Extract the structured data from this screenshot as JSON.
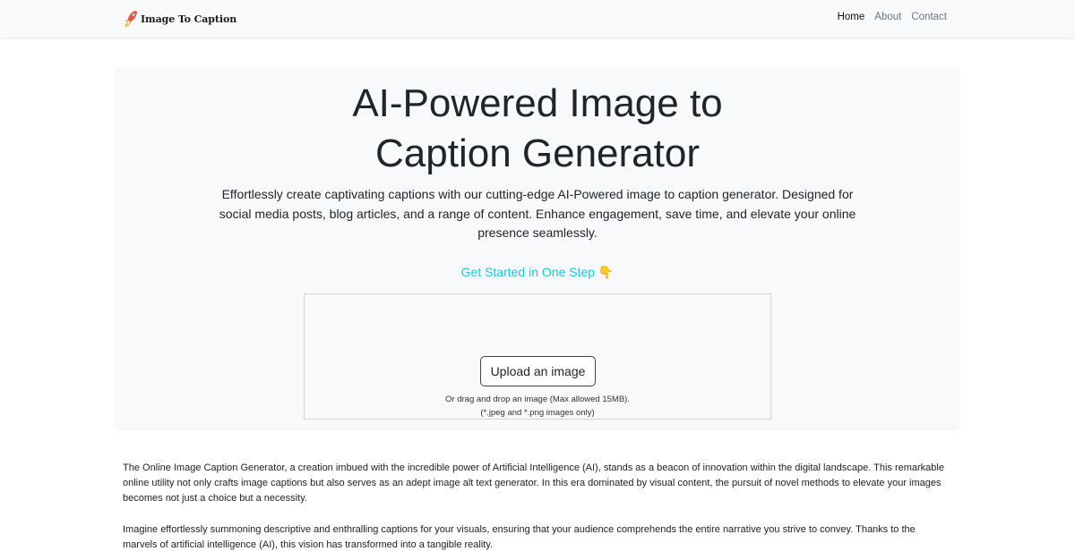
{
  "nav": {
    "brand": "Image To Caption",
    "links": [
      {
        "label": "Home",
        "active": true
      },
      {
        "label": "About",
        "active": false
      },
      {
        "label": "Contact",
        "active": false
      }
    ]
  },
  "hero": {
    "title_line1": "AI-Powered Image to",
    "title_line2": "Caption Generator",
    "description": "Effortlessly create captivating captions with our cutting-edge AI-Powered image to caption generator. Designed for social media posts, blog articles, and a range of content. Enhance engagement, save time, and elevate your online presence seamlessly.",
    "cta": "Get Started in One Step 👇",
    "cta_color": "#1ec6dc"
  },
  "upload": {
    "button_label": "Upload an image",
    "hint_line1": "Or drag and drop an image (Max allowed 15MB).",
    "hint_line2": "(*.jpeg and *.png images only)"
  },
  "content": {
    "paragraphs": [
      "The Online Image Caption Generator, a creation imbued with the incredible power of Artificial Intelligence (AI), stands as a beacon of innovation within the digital landscape. This remarkable online utility not only crafts image captions but also serves as an adept image alt text generator. In this era dominated by visual content, the pursuit of novel methods to elevate your images becomes not just a choice but a necessity.",
      "Imagine effortlessly summoning descriptive and enthralling captions for your visuals, ensuring that your audience comprehends the entire narrative you strive to convey. Thanks to the marvels of artificial intelligence (AI), this vision has transformed into a tangible reality."
    ]
  },
  "icons": {
    "brand": "rocket-icon",
    "cta": "pointing-down-hand-icon"
  }
}
